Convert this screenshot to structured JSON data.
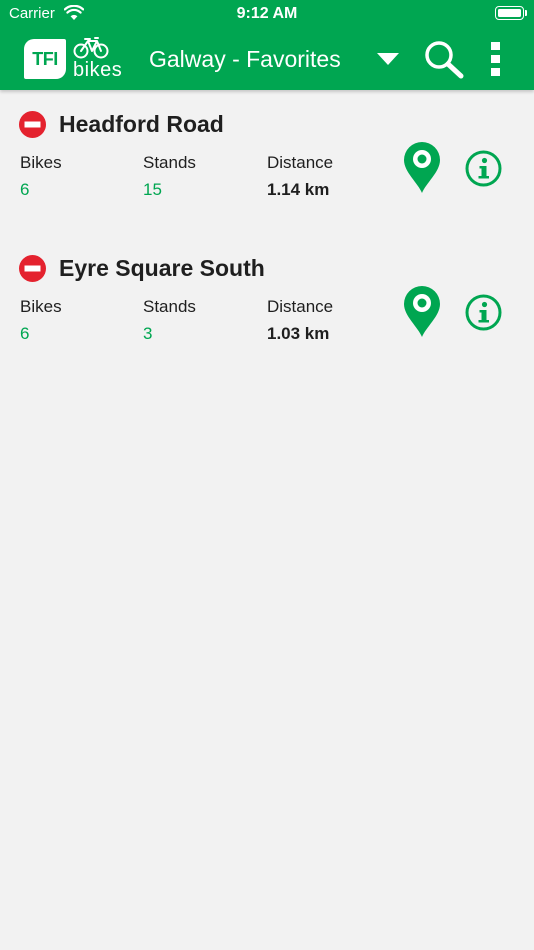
{
  "status_bar": {
    "carrier": "Carrier",
    "time": "9:12 AM"
  },
  "header": {
    "logo_box_text": "TFI",
    "logo_word": "bikes",
    "title": "Galway - Favorites"
  },
  "colors": {
    "brand_green": "#00a651",
    "status_unavailable": "#e4222e",
    "background": "#f2f2f2"
  },
  "icons": {
    "status": "no-entry-icon",
    "map": "map-pin-icon",
    "info": "info-icon",
    "search": "search-icon",
    "menu": "more-vertical-icon",
    "dropdown": "chevron-down-icon"
  },
  "stations": [
    {
      "name": "Headford Road",
      "bikes_label": "Bikes",
      "bikes": "6",
      "stands_label": "Stands",
      "stands": "15",
      "distance_label": "Distance",
      "distance": "1.14 km"
    },
    {
      "name": "Eyre Square South",
      "bikes_label": "Bikes",
      "bikes": "6",
      "stands_label": "Stands",
      "stands": "3",
      "distance_label": "Distance",
      "distance": "1.03 km"
    }
  ]
}
